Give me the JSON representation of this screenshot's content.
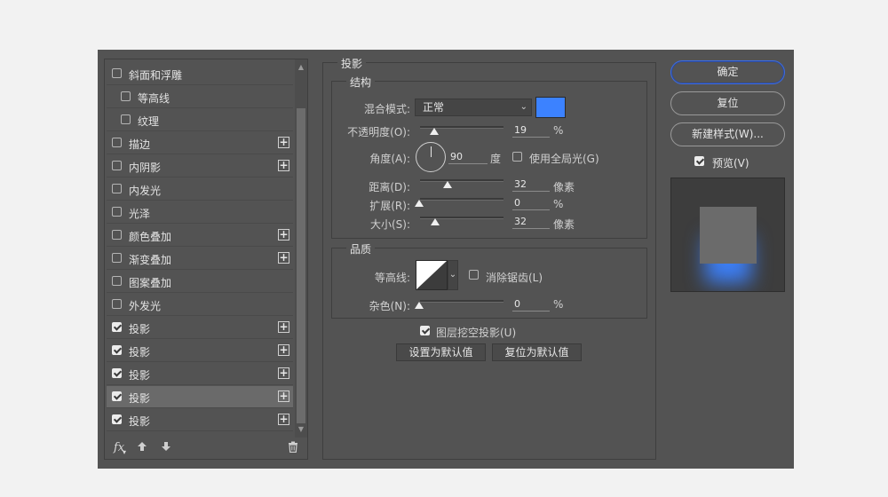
{
  "styles": [
    {
      "label": "斜面和浮雕",
      "checked": false,
      "plus": false,
      "indent": false
    },
    {
      "label": "等高线",
      "checked": false,
      "plus": false,
      "indent": true
    },
    {
      "label": "纹理",
      "checked": false,
      "plus": false,
      "indent": true
    },
    {
      "label": "描边",
      "checked": false,
      "plus": true,
      "indent": false
    },
    {
      "label": "内阴影",
      "checked": false,
      "plus": true,
      "indent": false
    },
    {
      "label": "内发光",
      "checked": false,
      "plus": false,
      "indent": false
    },
    {
      "label": "光泽",
      "checked": false,
      "plus": false,
      "indent": false
    },
    {
      "label": "颜色叠加",
      "checked": false,
      "plus": true,
      "indent": false
    },
    {
      "label": "渐变叠加",
      "checked": false,
      "plus": true,
      "indent": false
    },
    {
      "label": "图案叠加",
      "checked": false,
      "plus": false,
      "indent": false
    },
    {
      "label": "外发光",
      "checked": false,
      "plus": false,
      "indent": false
    },
    {
      "label": "投影",
      "checked": true,
      "plus": true,
      "indent": false
    },
    {
      "label": "投影",
      "checked": true,
      "plus": true,
      "indent": false
    },
    {
      "label": "投影",
      "checked": true,
      "plus": true,
      "indent": false
    },
    {
      "label": "投影",
      "checked": true,
      "plus": true,
      "indent": false,
      "active": true
    },
    {
      "label": "投影",
      "checked": true,
      "plus": true,
      "indent": false
    }
  ],
  "footer": {
    "fx": "fx",
    "up_icon": "arrow-up-icon",
    "down_icon": "arrow-down-icon",
    "trash_icon": "trash-icon"
  },
  "section_title": "投影",
  "structure": {
    "title": "结构",
    "blend_mode_label": "混合模式:",
    "blend_mode_value": "正常",
    "shadow_color": "#3c82ff",
    "opacity_label": "不透明度(O):",
    "opacity_value": "19",
    "opacity_unit": "%",
    "angle_label": "角度(A):",
    "angle_value": "90",
    "angle_unit": "度",
    "global_light_label": "使用全局光(G)",
    "global_light_checked": false,
    "distance_label": "距离(D):",
    "distance_value": "32",
    "distance_unit": "像素",
    "spread_label": "扩展(R):",
    "spread_value": "0",
    "spread_unit": "%",
    "size_label": "大小(S):",
    "size_value": "32",
    "size_unit": "像素"
  },
  "quality": {
    "title": "品质",
    "contour_label": "等高线:",
    "antialias_label": "消除锯齿(L)",
    "antialias_checked": false,
    "noise_label": "杂色(N):",
    "noise_value": "0",
    "noise_unit": "%"
  },
  "knockout_label": "图层挖空投影(U)",
  "knockout_checked": true,
  "make_default_label": "设置为默认值",
  "reset_default_label": "复位为默认值",
  "buttons": {
    "ok": "确定",
    "reset": "复位",
    "new_style": "新建样式(W)..."
  },
  "preview_label": "预览(V)",
  "preview_checked": true
}
